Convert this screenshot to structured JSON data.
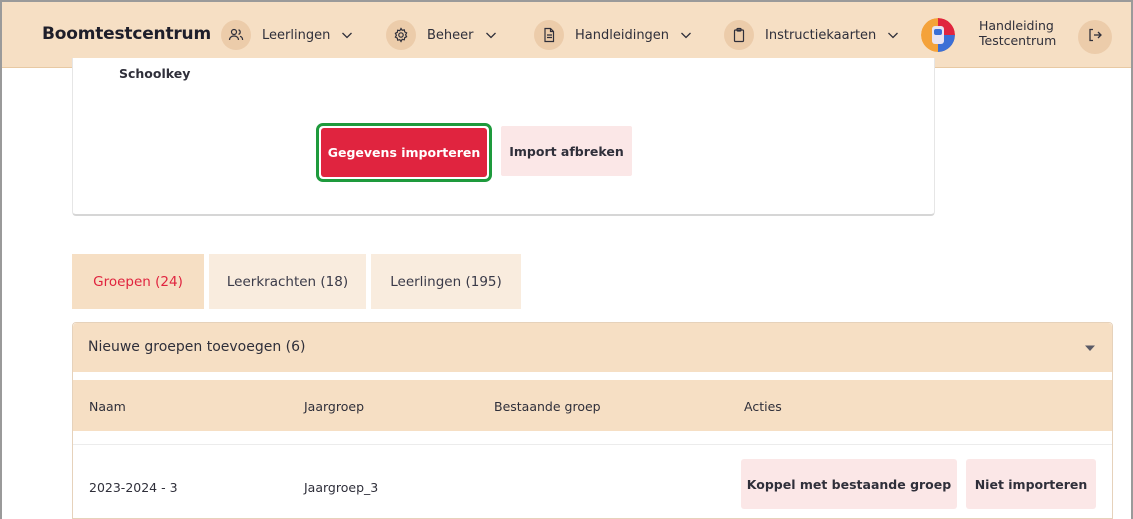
{
  "header": {
    "brand": "Boomtestcentrum",
    "nav": [
      {
        "label": "Leerlingen",
        "icon": "users-icon"
      },
      {
        "label": "Beheer",
        "icon": "gear-icon"
      },
      {
        "label": "Handleidingen",
        "icon": "document-icon"
      },
      {
        "label": "Instructiekaarten",
        "icon": "clipboard-icon"
      }
    ],
    "user_line1": "Handleiding",
    "user_line2": "Testcentrum",
    "logout_icon": "logout-icon"
  },
  "import_card": {
    "school_label": "Schoolkey",
    "import_button": "Gegevens importeren",
    "abort_button": "Import afbreken"
  },
  "tabs": [
    {
      "label": "Groepen (24)",
      "active": true
    },
    {
      "label": "Leerkrachten (18)",
      "active": false
    },
    {
      "label": "Leerlingen (195)",
      "active": false
    }
  ],
  "section": {
    "title": "Nieuwe groepen toevoegen (6)",
    "columns": [
      "Naam",
      "Jaargroep",
      "Bestaande groep",
      "Acties"
    ],
    "rows": [
      {
        "naam": "2023-2024 - 3",
        "jaargroep": "Jaargroep_3",
        "bestaande_groep": "",
        "action_link": "Koppel met bestaande groep",
        "action_skip": "Niet importeren"
      }
    ]
  },
  "colors": {
    "accent": "#e0243f",
    "header_bg": "#f6dfc4",
    "highlight": "#1e9a3c",
    "soft_button": "#fbe7e7"
  }
}
